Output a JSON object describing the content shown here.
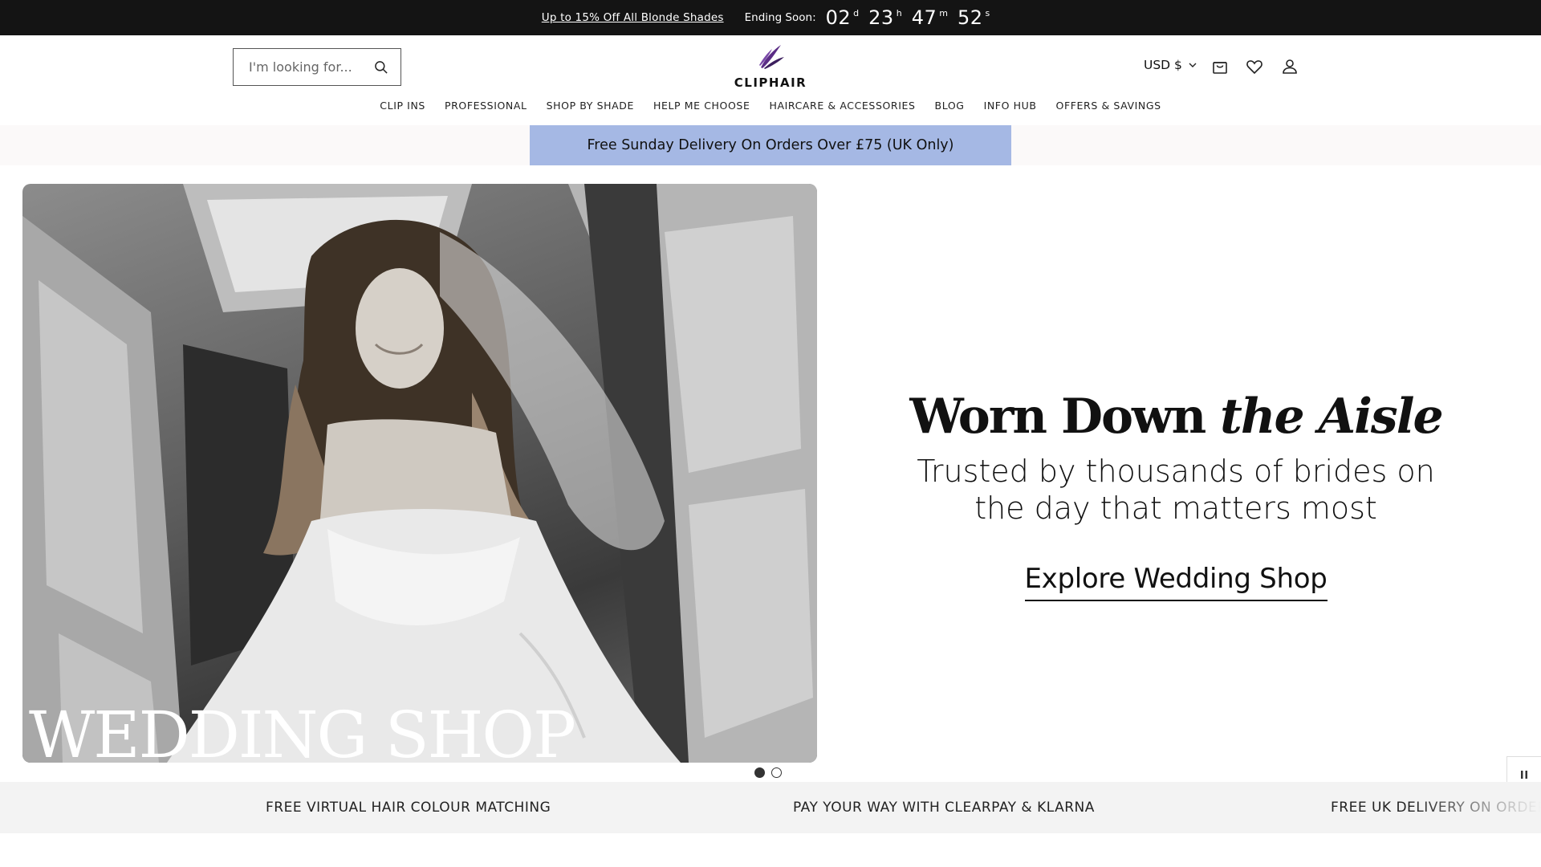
{
  "announcement": {
    "link_text": "Up to 15% Off All Blonde Shades",
    "ending_label": "Ending Soon:",
    "countdown": [
      {
        "value": "02",
        "unit": "d"
      },
      {
        "value": "23",
        "unit": "h"
      },
      {
        "value": "47",
        "unit": "m"
      },
      {
        "value": "52",
        "unit": "s"
      }
    ]
  },
  "header": {
    "search_placeholder": "I'm looking for...",
    "logo_text": "CLIPHAIR",
    "currency": "USD $",
    "brand_color": "#4a2a6e"
  },
  "nav": {
    "items": [
      "CLIP INS",
      "PROFESSIONAL",
      "SHOP BY SHADE",
      "HELP ME CHOOSE",
      "HAIRCARE & ACCESSORIES",
      "BLOG",
      "INFO HUB",
      "OFFERS & SAVINGS"
    ]
  },
  "promo": {
    "text": "Free Sunday Delivery On Orders Over £75 (UK Only)",
    "color": "#a5b8e4"
  },
  "hero": {
    "image_caption": "WEDDING SHOP",
    "title_plain": "Worn Down ",
    "title_italic": "the Aisle",
    "subtitle": "Trusted by thousands of brides on the day that matters most",
    "cta": "Explore Wedding Shop",
    "slides_total": 2,
    "active_slide": 1
  },
  "usp": {
    "items": [
      "FREE VIRTUAL HAIR COLOUR MATCHING",
      "PAY YOUR WAY WITH CLEARPAY & KLARNA",
      "FREE UK DELIVERY ON ORDERS"
    ]
  }
}
